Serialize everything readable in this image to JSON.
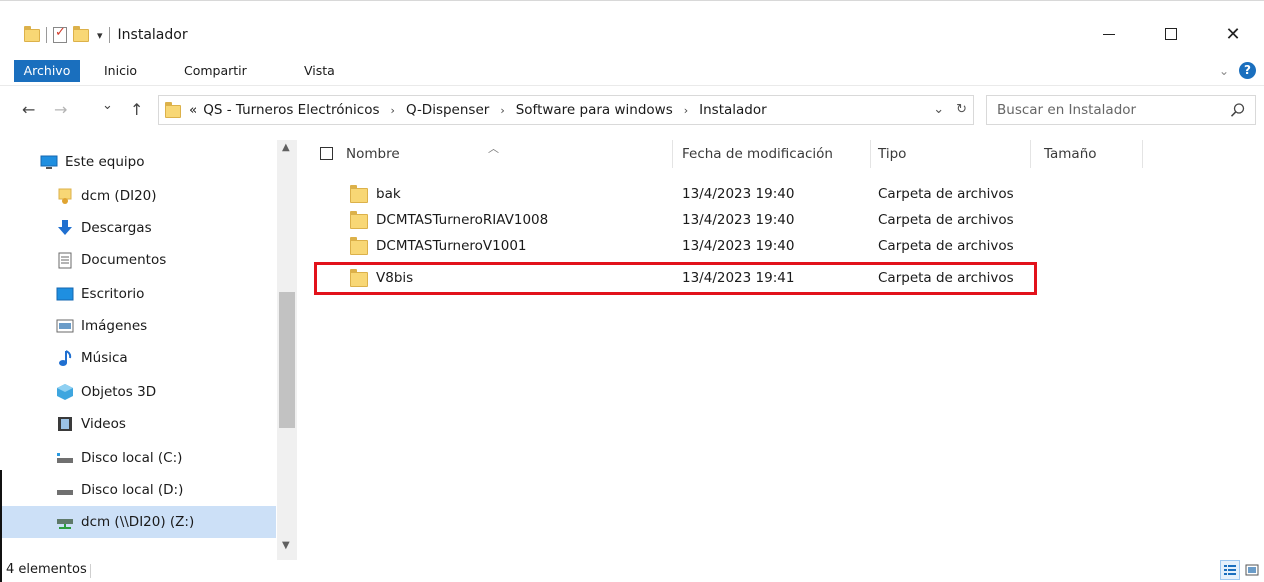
{
  "window": {
    "title": "Instalador",
    "qat_dropdown": "▾"
  },
  "ribbon": {
    "tabs": [
      "Archivo",
      "Inicio",
      "Compartir",
      "Vista"
    ]
  },
  "nav": {
    "back": "←",
    "forward": "→",
    "recent": "⌄",
    "up": "↑",
    "overflow": "«",
    "breadcrumb": [
      "QS - Turneros Electrónicos",
      "Q-Dispenser",
      "Software para windows",
      "Instalador"
    ],
    "search_placeholder": "Buscar en Instalador"
  },
  "sidebar": {
    "items": [
      {
        "label": "Este equipo",
        "icon": "computer-icon"
      },
      {
        "label": "dcm (DI20)",
        "icon": "user-folder-icon"
      },
      {
        "label": "Descargas",
        "icon": "download-icon"
      },
      {
        "label": "Documentos",
        "icon": "documents-icon"
      },
      {
        "label": "Escritorio",
        "icon": "desktop-icon"
      },
      {
        "label": "Imágenes",
        "icon": "pictures-icon"
      },
      {
        "label": "Música",
        "icon": "music-icon"
      },
      {
        "label": "Objetos 3D",
        "icon": "3d-objects-icon"
      },
      {
        "label": "Videos",
        "icon": "videos-icon"
      },
      {
        "label": "Disco local (C:)",
        "icon": "drive-icon"
      },
      {
        "label": "Disco local (D:)",
        "icon": "drive-icon"
      },
      {
        "label": "dcm (\\\\DI20) (Z:)",
        "icon": "network-drive-icon",
        "selected": true
      }
    ]
  },
  "columns": [
    "Nombre",
    "Fecha de modificación",
    "Tipo",
    "Tamaño"
  ],
  "files": [
    {
      "name": "bak",
      "date": "13/4/2023 19:40",
      "type": "Carpeta de archivos",
      "size": ""
    },
    {
      "name": "DCMTASTurneroRIAV1008",
      "date": "13/4/2023 19:40",
      "type": "Carpeta de archivos",
      "size": ""
    },
    {
      "name": "DCMTASTurneroV1001",
      "date": "13/4/2023 19:40",
      "type": "Carpeta de archivos",
      "size": ""
    },
    {
      "name": "V8bis",
      "date": "13/4/2023 19:41",
      "type": "Carpeta de archivos",
      "size": "",
      "highlighted": true
    }
  ],
  "status": {
    "count": "4 elementos"
  },
  "colors": {
    "accent": "#1a6fbe",
    "selection": "#cce0f7",
    "highlight_box": "#e2121b",
    "folder": "#f8d775"
  }
}
